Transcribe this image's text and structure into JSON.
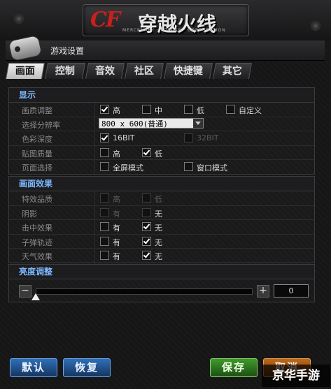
{
  "app": {
    "logo_text": "穿越火线",
    "logo_cf": "CF",
    "logo_sub": "MERCENARY · FORCES · CORPORATION"
  },
  "window": {
    "title": "游戏设置"
  },
  "tabs": [
    {
      "label": "画面",
      "active": true
    },
    {
      "label": "控制",
      "active": false
    },
    {
      "label": "音效",
      "active": false
    },
    {
      "label": "社区",
      "active": false
    },
    {
      "label": "快捷键",
      "active": false
    },
    {
      "label": "其它",
      "active": false
    }
  ],
  "display": {
    "heading": "显示",
    "quality_label": "画质调整",
    "quality_options": [
      {
        "text": "高",
        "checked": true
      },
      {
        "text": "中",
        "checked": false
      },
      {
        "text": "低",
        "checked": false
      },
      {
        "text": "自定义",
        "checked": false
      }
    ],
    "resolution_label": "选择分辨率",
    "resolution_value": "800 x 600(普通)",
    "color_depth_label": "色彩深度",
    "color_depth_options": [
      {
        "text": "16BIT",
        "checked": true
      },
      {
        "text": "32BIT",
        "checked": false,
        "dim": true
      }
    ],
    "texture_label": "贴图质量",
    "texture_options": [
      {
        "text": "高",
        "checked": false
      },
      {
        "text": "低",
        "checked": true
      }
    ],
    "page_mode_label": "页面选择",
    "page_mode_options": [
      {
        "text": "全屏模式",
        "checked": false
      },
      {
        "text": "窗口模式",
        "checked": false
      }
    ]
  },
  "effects": {
    "heading": "画面效果",
    "special_quality_label": "特效品质",
    "special_quality_options": [
      {
        "text": "高",
        "checked": false,
        "dim": true
      },
      {
        "text": "低",
        "checked": false,
        "dim": true
      }
    ],
    "shadow_label": "阴影",
    "shadow_options": [
      {
        "text": "有",
        "checked": false,
        "dim": true
      },
      {
        "text": "无",
        "checked": false,
        "dim": true
      }
    ],
    "hit_label": "击中效果",
    "hit_options": [
      {
        "text": "有",
        "checked": false
      },
      {
        "text": "无",
        "checked": true
      }
    ],
    "bullet_label": "子弹轨迹",
    "bullet_options": [
      {
        "text": "有",
        "checked": false
      },
      {
        "text": "无",
        "checked": true
      }
    ],
    "weather_label": "天气效果",
    "weather_options": [
      {
        "text": "有",
        "checked": false
      },
      {
        "text": "无",
        "checked": true
      }
    ]
  },
  "brightness": {
    "heading": "亮度调整",
    "minus": "−",
    "plus": "+",
    "value": "0",
    "level_fraction": 0.0
  },
  "buttons": {
    "default": "默认",
    "restore": "恢复",
    "save": "保存",
    "cancel": "取消"
  },
  "watermark": "京华手游",
  "colors": {
    "heading": "#7cb8ff",
    "blue_btn": "#2f6fb8",
    "green_btn": "#3f9a2c",
    "orange_btn": "#c06a1a"
  }
}
